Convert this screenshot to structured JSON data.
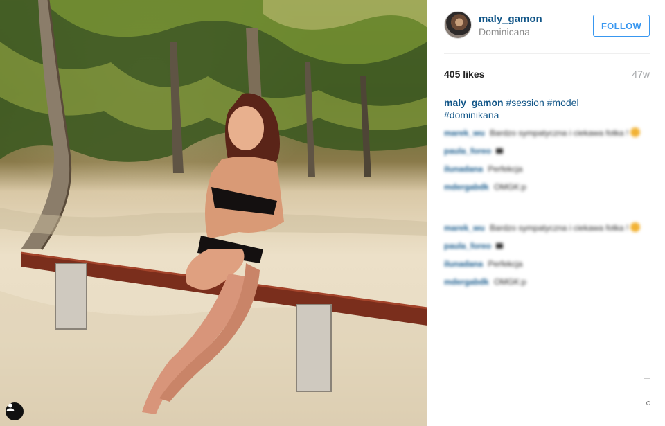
{
  "post": {
    "username": "maly_gamon",
    "location": "Dominicana",
    "follow_label": "FOLLOW",
    "likes": "405 likes",
    "age": "47w",
    "caption": {
      "user": "maly_gamon",
      "tags": [
        "#session",
        "#model",
        "#dominikana"
      ]
    },
    "comments_block_1": [
      {
        "user": "marek_wu",
        "text": "Bardzo sympatyczna i ciekawa fotka !"
      },
      {
        "user": "paula_foreo",
        "text": ""
      },
      {
        "user": "ilunadana",
        "text": "Perfekcja"
      },
      {
        "user": "mdergabdk",
        "text": "OMGK:p"
      }
    ],
    "comments_block_2": [
      {
        "user": "marek_wu",
        "text": "Bardzo sympatyczna i ciekawa fotka !"
      },
      {
        "user": "paula_foreo",
        "text": ""
      },
      {
        "user": "ilunadana",
        "text": "Perfekcja"
      },
      {
        "user": "mdergabdk",
        "text": "OMGK:p"
      }
    ]
  },
  "colors": {
    "link": "#125688",
    "follow": "#3897f0",
    "muted": "#a5a7aa"
  },
  "icons": {
    "user_tag": "person-icon",
    "options": "more-dot-icon"
  }
}
